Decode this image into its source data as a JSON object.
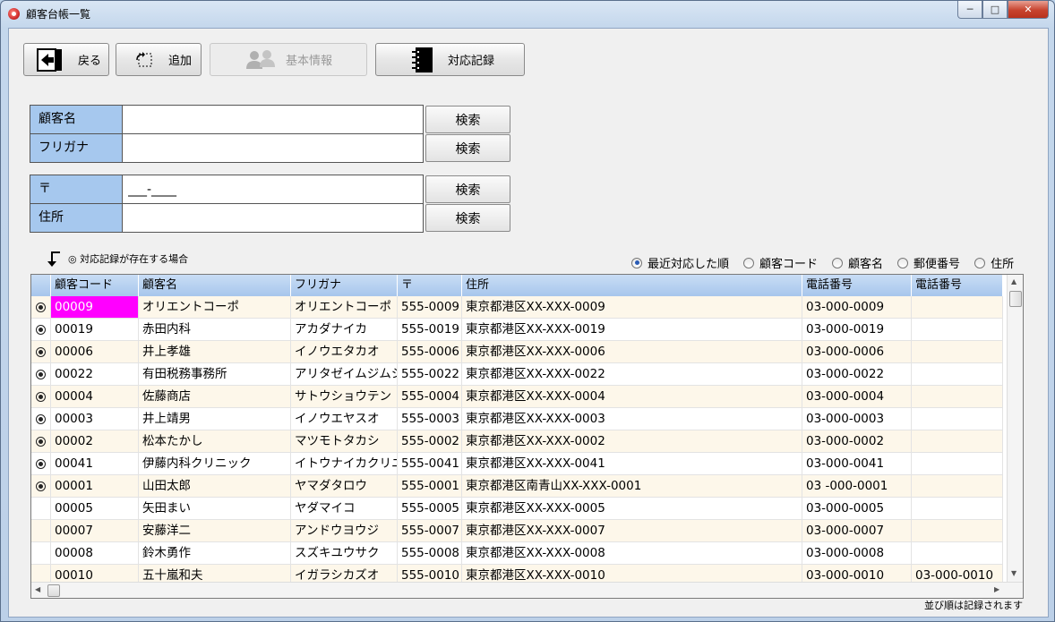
{
  "window": {
    "title": "顧客台帳一覧"
  },
  "toolbar": {
    "back_label": "戻る",
    "add_label": "追加",
    "basic_info_label": "基本情報",
    "record_label": "対応記録"
  },
  "search": {
    "name_label": "顧客名",
    "name_value": "",
    "kana_label": "フリガナ",
    "kana_value": "",
    "zip_label": "〒",
    "zip_value": "___-____",
    "address_label": "住所",
    "address_value": "",
    "search_button": "検索"
  },
  "note_text": "◎ 対応記録が存在する場合",
  "sort": {
    "options": [
      "最近対応した順",
      "顧客コード",
      "顧客名",
      "郵便番号",
      "住所"
    ],
    "selected": 0
  },
  "table": {
    "columns": [
      "顧客コード",
      "顧客名",
      "フリガナ",
      "〒",
      "住所",
      "電話番号",
      "電話番号"
    ],
    "rows": [
      {
        "mark": true,
        "code": "00009",
        "name": "オリエントコーポ",
        "kana": "オリエントコーポ",
        "zip": "555-0009",
        "address": "東京都港区XX-XXX-0009",
        "tel1": "03-000-0009",
        "tel2": ""
      },
      {
        "mark": true,
        "code": "00019",
        "name": "赤田内科",
        "kana": "アカダナイカ",
        "zip": "555-0019",
        "address": "東京都港区XX-XXX-0019",
        "tel1": "03-000-0019",
        "tel2": ""
      },
      {
        "mark": true,
        "code": "00006",
        "name": "井上孝雄",
        "kana": "イノウエタカオ",
        "zip": "555-0006",
        "address": "東京都港区XX-XXX-0006",
        "tel1": "03-000-0006",
        "tel2": ""
      },
      {
        "mark": true,
        "code": "00022",
        "name": "有田税務事務所",
        "kana": "アリタゼイムジムショ",
        "zip": "555-0022",
        "address": "東京都港区XX-XXX-0022",
        "tel1": "03-000-0022",
        "tel2": ""
      },
      {
        "mark": true,
        "code": "00004",
        "name": "佐藤商店",
        "kana": "サトウショウテン",
        "zip": "555-0004",
        "address": "東京都港区XX-XXX-0004",
        "tel1": "03-000-0004",
        "tel2": ""
      },
      {
        "mark": true,
        "code": "00003",
        "name": "井上靖男",
        "kana": "イノウエヤスオ",
        "zip": "555-0003",
        "address": "東京都港区XX-XXX-0003",
        "tel1": "03-000-0003",
        "tel2": ""
      },
      {
        "mark": true,
        "code": "00002",
        "name": "松本たかし",
        "kana": "マツモトタカシ",
        "zip": "555-0002",
        "address": "東京都港区XX-XXX-0002",
        "tel1": "03-000-0002",
        "tel2": ""
      },
      {
        "mark": true,
        "code": "00041",
        "name": "伊藤内科クリニック",
        "kana": "イトウナイカクリニック",
        "zip": "555-0041",
        "address": "東京都港区XX-XXX-0041",
        "tel1": "03-000-0041",
        "tel2": ""
      },
      {
        "mark": true,
        "code": "00001",
        "name": "山田太郎",
        "kana": "ヤマダタロウ",
        "zip": "555-0001",
        "address": "東京都港区南青山XX-XXX-0001",
        "tel1": "03 -000-0001",
        "tel2": ""
      },
      {
        "mark": false,
        "code": "00005",
        "name": "矢田まい",
        "kana": "ヤダマイコ",
        "zip": "555-0005",
        "address": "東京都港区XX-XXX-0005",
        "tel1": "03-000-0005",
        "tel2": ""
      },
      {
        "mark": false,
        "code": "00007",
        "name": "安藤洋二",
        "kana": "アンドウヨウジ",
        "zip": "555-0007",
        "address": "東京都港区XX-XXX-0007",
        "tel1": "03-000-0007",
        "tel2": ""
      },
      {
        "mark": false,
        "code": "00008",
        "name": "鈴木勇作",
        "kana": "スズキユウサク",
        "zip": "555-0008",
        "address": "東京都港区XX-XXX-0008",
        "tel1": "03-000-0008",
        "tel2": ""
      },
      {
        "mark": false,
        "code": "00010",
        "name": "五十嵐和夫",
        "kana": "イガラシカズオ",
        "zip": "555-0010",
        "address": "東京都港区XX-XXX-0010",
        "tel1": "03-000-0010",
        "tel2": "03-000-0010"
      }
    ]
  },
  "footer_note": "並び順は記録されます"
}
